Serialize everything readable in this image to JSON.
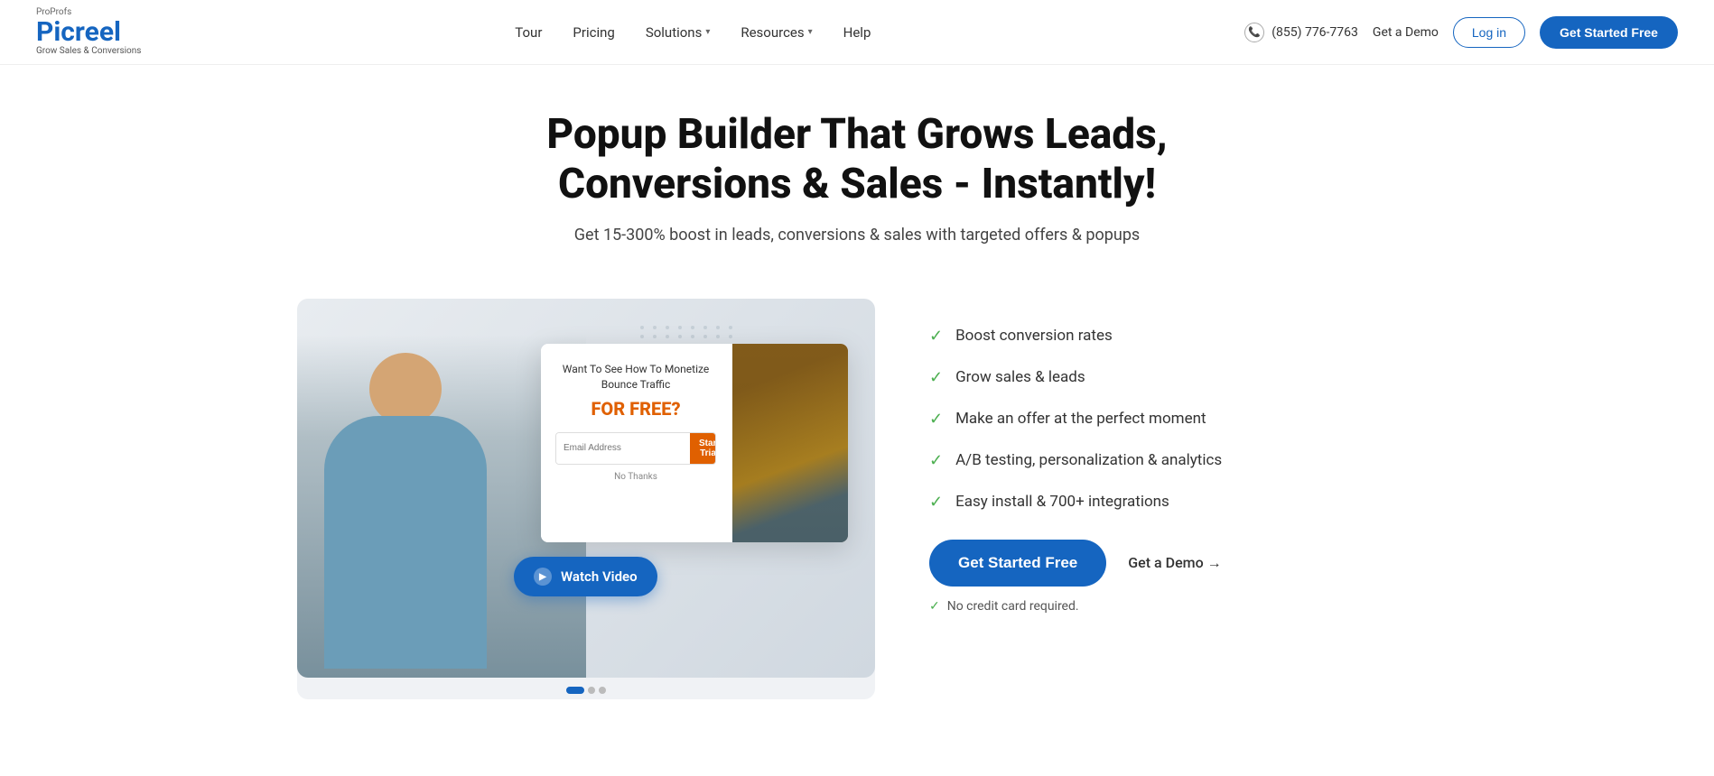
{
  "brand": {
    "proprofs": "ProProfs",
    "name": "Picreel",
    "tagline": "Grow Sales & Conversions"
  },
  "nav": {
    "items": [
      {
        "label": "Tour",
        "hasDropdown": false
      },
      {
        "label": "Pricing",
        "hasDropdown": false
      },
      {
        "label": "Solutions",
        "hasDropdown": true
      },
      {
        "label": "Resources",
        "hasDropdown": true
      },
      {
        "label": "Help",
        "hasDropdown": false
      }
    ]
  },
  "header": {
    "phone": "(855) 776-7763",
    "get_demo": "Get a Demo",
    "login": "Log in",
    "get_started": "Get Started Free"
  },
  "hero": {
    "headline": "Popup Builder That Grows Leads, Conversions & Sales - Instantly!",
    "subheadline": "Get 15-300% boost in leads, conversions & sales with targeted offers & popups"
  },
  "popup_mockup": {
    "title": "Want To See How To Monetize Bounce Traffic",
    "for_free": "FOR FREE?",
    "email_placeholder": "Email Address",
    "start_trial": "Start Trial",
    "no_thanks": "No Thanks"
  },
  "watch_video": {
    "label": "Watch Video"
  },
  "features": [
    "Boost conversion rates",
    "Grow sales & leads",
    "Make an offer at the perfect moment",
    "A/B testing, personalization & analytics",
    "Easy install & 700+ integrations"
  ],
  "cta": {
    "get_started": "Get Started Free",
    "get_demo": "Get a Demo →",
    "no_cc": "No credit card required."
  },
  "scroll_dots": [
    "active",
    "",
    ""
  ]
}
